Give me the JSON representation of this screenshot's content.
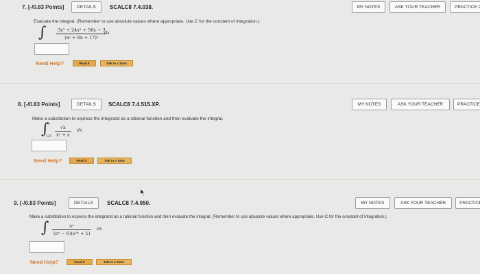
{
  "common": {
    "details_label": "DETAILS",
    "my_notes_label": "MY NOTES",
    "ask_teacher_label": "ASK YOUR TEACHER",
    "practice_label": "PRACTICE ANOTHER",
    "need_help_label": "Need Help?",
    "read_it_label": "Read It",
    "talk_tutor_label": "Talk to a Tutor"
  },
  "questions": [
    {
      "number": "7.",
      "points": "[-/0.83 Points]",
      "code": "SCALC8 7.4.038.",
      "instruction": "Evaluate the integral. (Remember to use absolute values where appropriate. Use C for the constant of integration.)",
      "numerator": "3x³ + 24x² + 56x − 3",
      "denominator": "(x² + 8x + 17)²",
      "differential": "dx",
      "answer_value": ""
    },
    {
      "number": "8.",
      "points": "[-/0.83 Points]",
      "code": "SCALC8 7.4.515.XP.",
      "instruction": "Make a substitution to express the integrand as a rational function and then evaluate the integral.",
      "lower_limit": "1/3",
      "upper_limit": "1",
      "numerator": "√x",
      "denominator": "x² + x",
      "differential": "dx",
      "answer_value": ""
    },
    {
      "number": "9.",
      "points": "[-/0.83 Points]",
      "code": "SCALC8 7.4.050.",
      "instruction": "Make a substitution to express the integrand as a rational function and then evaluate the integral. (Remember to use absolute values where appropriate. Use C for the constant of integration.)",
      "numerator": "eˣ",
      "denominator": "(eˣ − 6)(e²ˣ + 1)",
      "differential": "dx",
      "answer_value": ""
    }
  ],
  "colors": {
    "background": "#e9e9e7",
    "help_text": "#d07c3a",
    "help_button": "#e3a84c"
  }
}
